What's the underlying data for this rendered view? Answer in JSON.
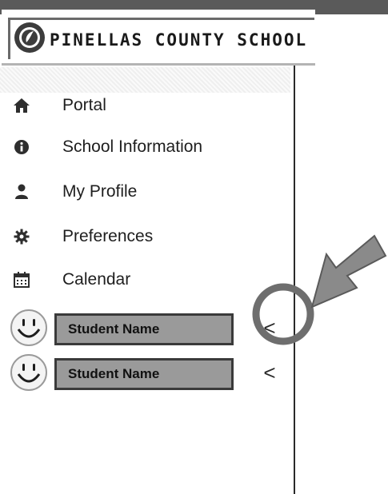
{
  "header": {
    "brand": "PINELLAS COUNTY SCHOOL"
  },
  "sidebar": {
    "items": [
      {
        "label": "Portal",
        "icon": "home-icon"
      },
      {
        "label": "School Information",
        "icon": "info-icon"
      },
      {
        "label": "My Profile",
        "icon": "user-icon"
      },
      {
        "label": "Preferences",
        "icon": "gear-icon"
      },
      {
        "label": "Calendar",
        "icon": "calendar-icon"
      }
    ],
    "students": [
      {
        "label": "Student Name",
        "avatar": "smiley-avatar",
        "toggle": "<"
      },
      {
        "label": "Student Name",
        "avatar": "smiley-avatar",
        "toggle": "<"
      }
    ]
  },
  "colors": {
    "student_button_bg": "#9a9a9a",
    "annotation": "#6e6e6e"
  }
}
